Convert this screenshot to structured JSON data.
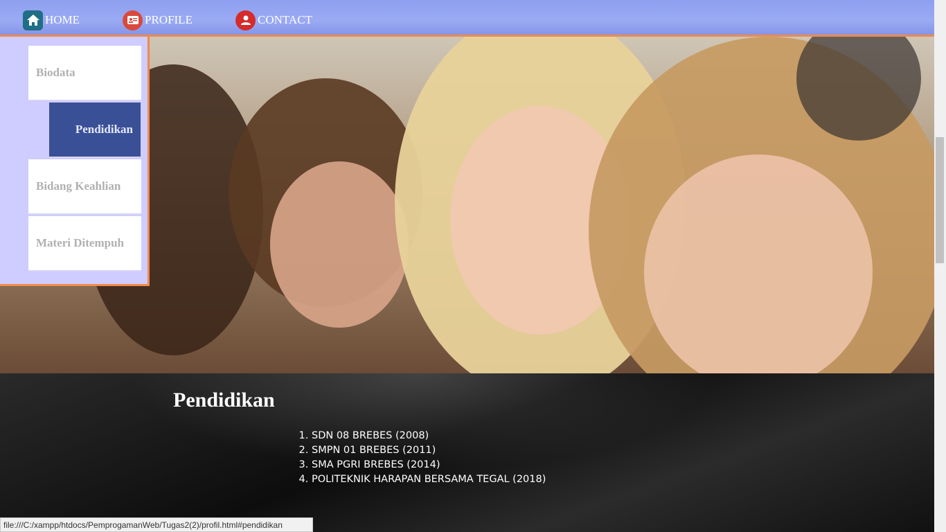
{
  "nav": {
    "items": [
      {
        "label": "HOME",
        "icon": "home-icon"
      },
      {
        "label": "PROFILE",
        "icon": "id-card-icon"
      },
      {
        "label": "CONTACT",
        "icon": "person-icon"
      }
    ]
  },
  "sidebar": {
    "items": [
      {
        "label": "Biodata"
      },
      {
        "label": "Pendidikan"
      },
      {
        "label": "Bidang Keahlian"
      },
      {
        "label": "Materi Ditempuh"
      }
    ]
  },
  "content": {
    "title": "Pendidikan",
    "list": [
      "SDN 08 BREBES (2008)",
      "SMPN 01 BREBES (2011)",
      "SMA PGRI BREBES (2014)",
      "POLITEKNIK HARAPAN BERSAMA TEGAL (2018)"
    ]
  },
  "status": {
    "url": "file:///C:/xampp/htdocs/PemprogamanWeb/Tugas2(2)/profil.html#pendidikan"
  },
  "colors": {
    "accent": "#f08a4b",
    "nav": "#8e9ff0",
    "sidebar": "#cfccff",
    "active": "#3a5096"
  }
}
